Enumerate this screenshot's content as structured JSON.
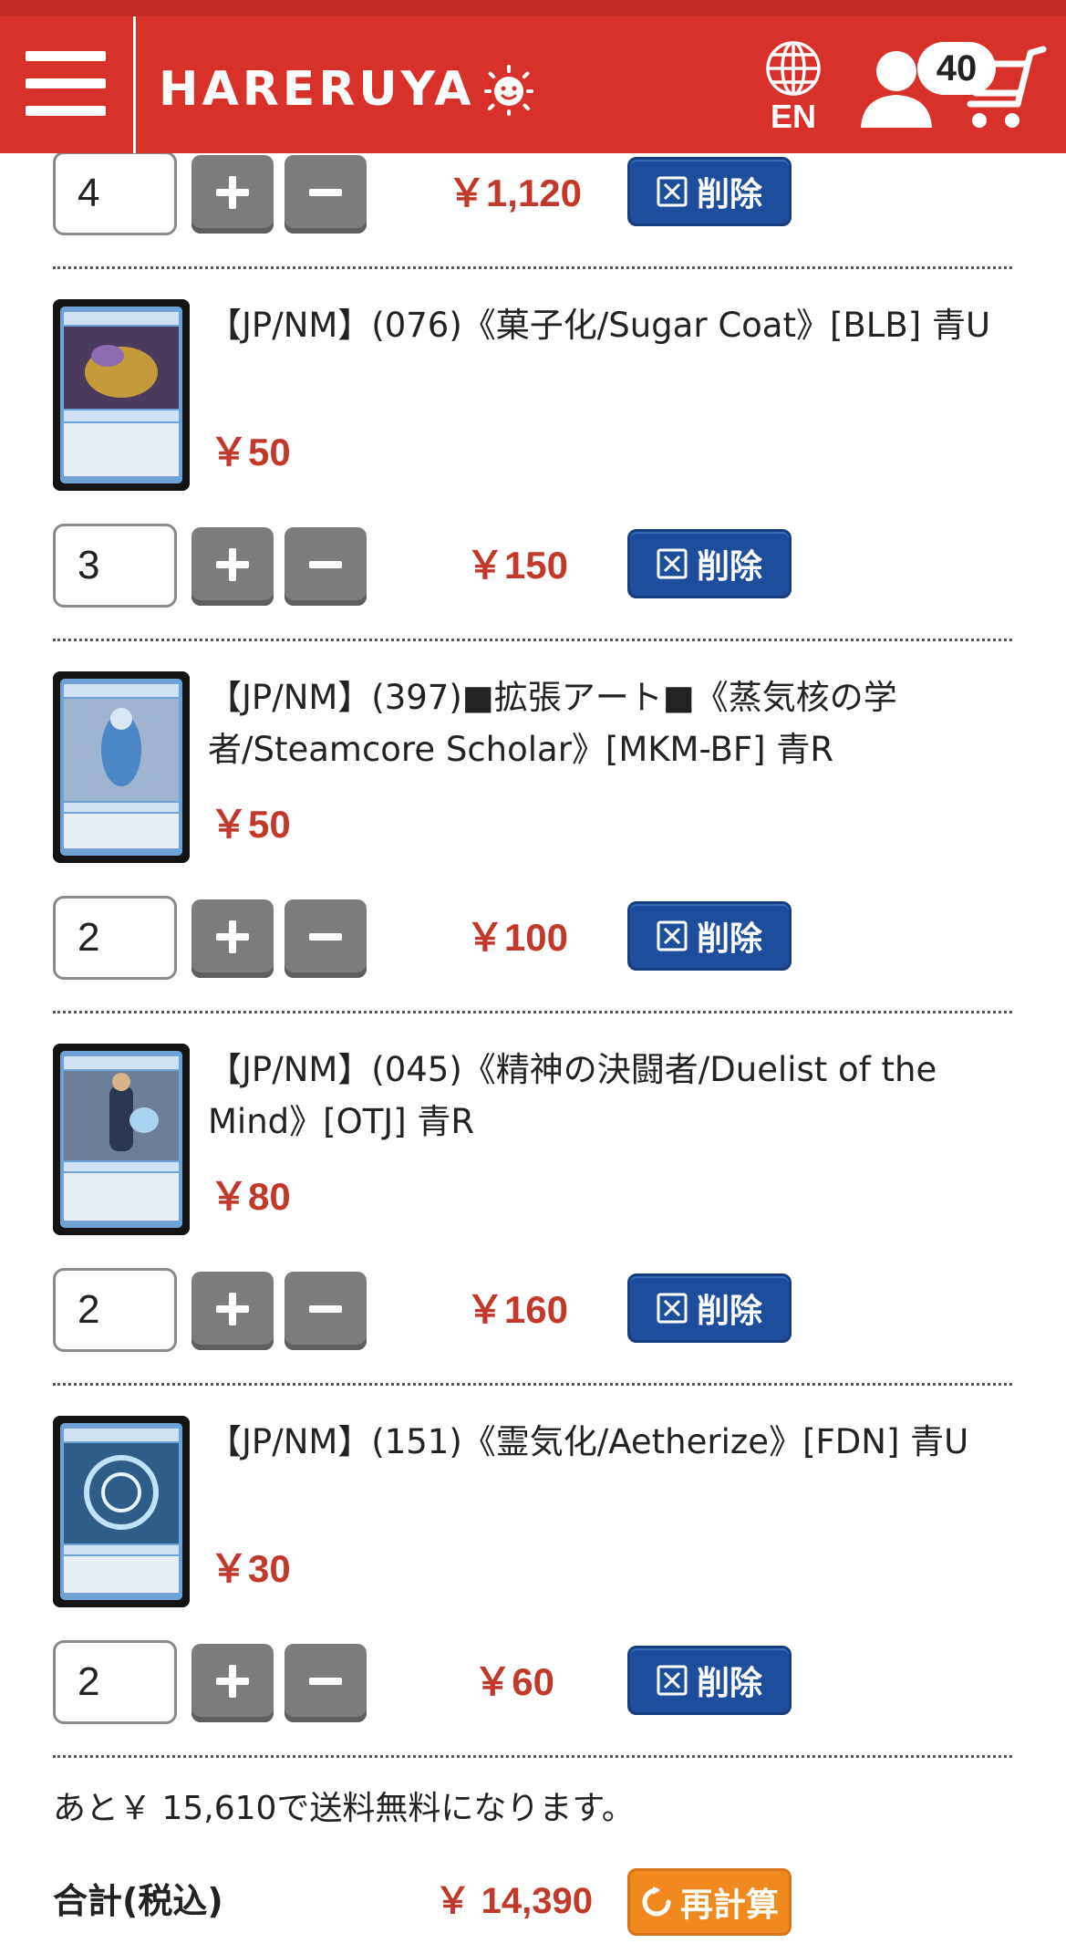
{
  "header": {
    "logo_text": "HARERUYA",
    "language_label": "EN",
    "cart_count": "40",
    "colors": {
      "bar": "#d7312a",
      "text": "#ffffff"
    }
  },
  "cart": {
    "delete_label": "削除",
    "first_row": {
      "quantity": "4",
      "line_total": "￥1,120"
    },
    "items": [
      {
        "title": "【JP/NM】(076)《菓子化/Sugar Coat》[BLB] 青U",
        "unit_price": "￥50",
        "quantity": "3",
        "line_total": "￥150"
      },
      {
        "title": "【JP/NM】(397)■拡張アート■《蒸気核の学者/Steamcore Scholar》[MKM-BF] 青R",
        "unit_price": "￥50",
        "quantity": "2",
        "line_total": "￥100"
      },
      {
        "title": "【JP/NM】(045)《精神の決闘者/Duelist of the Mind》[OTJ] 青R",
        "unit_price": "￥80",
        "quantity": "2",
        "line_total": "￥160"
      },
      {
        "title": "【JP/NM】(151)《霊気化/Aetherize》[FDN] 青U",
        "unit_price": "￥30",
        "quantity": "2",
        "line_total": "￥60"
      }
    ]
  },
  "summary": {
    "shipping_note": "あと￥ 15,610で送料無料になります。",
    "total_label": "合計(税込)",
    "total_value": "￥ 14,390",
    "recalc_label": "再計算"
  },
  "colors": {
    "price": "#c0392b",
    "delete_button": "#1d4e9b",
    "recalc_button": "#f08a1e",
    "stepper": "#7c7c7c"
  }
}
